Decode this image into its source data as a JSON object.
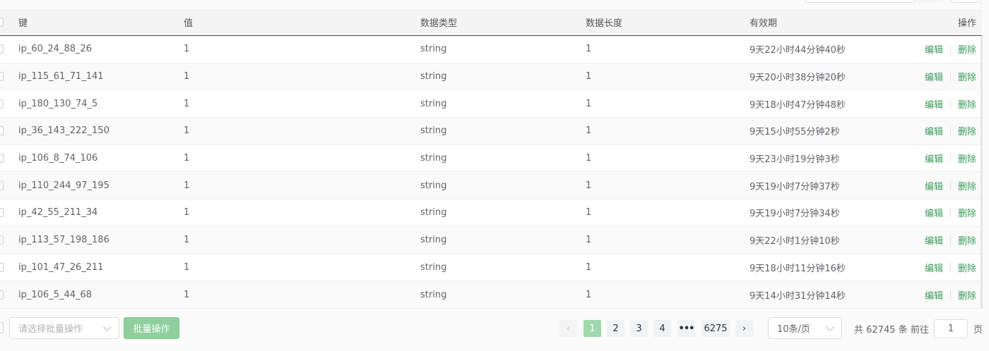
{
  "table": {
    "headers": {
      "key": "键",
      "value": "值",
      "type": "数据类型",
      "length": "数据长度",
      "ttl": "有效期",
      "actions": "操作"
    },
    "rows": [
      {
        "key": "ip_60_24_88_26",
        "value": "1",
        "type": "string",
        "length": "1",
        "ttl": "9天22小时44分钟40秒"
      },
      {
        "key": "ip_115_61_71_141",
        "value": "1",
        "type": "string",
        "length": "1",
        "ttl": "9天20小时38分钟20秒"
      },
      {
        "key": "ip_180_130_74_5",
        "value": "1",
        "type": "string",
        "length": "1",
        "ttl": "9天18小时47分钟48秒"
      },
      {
        "key": "ip_36_143_222_150",
        "value": "1",
        "type": "string",
        "length": "1",
        "ttl": "9天15小时55分钟2秒"
      },
      {
        "key": "ip_106_8_74_106",
        "value": "1",
        "type": "string",
        "length": "1",
        "ttl": "9天23小时19分钟3秒"
      },
      {
        "key": "ip_110_244_97_195",
        "value": "1",
        "type": "string",
        "length": "1",
        "ttl": "9天19小时7分钟37秒"
      },
      {
        "key": "ip_42_55_211_34",
        "value": "1",
        "type": "string",
        "length": "1",
        "ttl": "9天19小时7分钟34秒"
      },
      {
        "key": "ip_113_57_198_186",
        "value": "1",
        "type": "string",
        "length": "1",
        "ttl": "9天22小时1分钟10秒"
      },
      {
        "key": "ip_101_47_26_211",
        "value": "1",
        "type": "string",
        "length": "1",
        "ttl": "9天18小时11分钟16秒"
      },
      {
        "key": "ip_106_5_44_68",
        "value": "1",
        "type": "string",
        "length": "1",
        "ttl": "9天14小时31分钟14秒"
      }
    ],
    "edit_label": "编辑",
    "delete_label": "删除"
  },
  "footer": {
    "batch_select_placeholder": "请选择批量操作",
    "batch_button": "批量操作",
    "pagination": {
      "prev": "‹",
      "pages": [
        "1",
        "2",
        "3",
        "4"
      ],
      "more": "•••",
      "last": "6275",
      "next": "›",
      "current": "1"
    },
    "page_size": "10条/页",
    "total": "共 62745 条",
    "goto_label": "前往",
    "goto_value": "1",
    "page_suffix": "页"
  },
  "colors": {
    "link": "#3c9a5a",
    "accent": "#9fd8ad"
  }
}
